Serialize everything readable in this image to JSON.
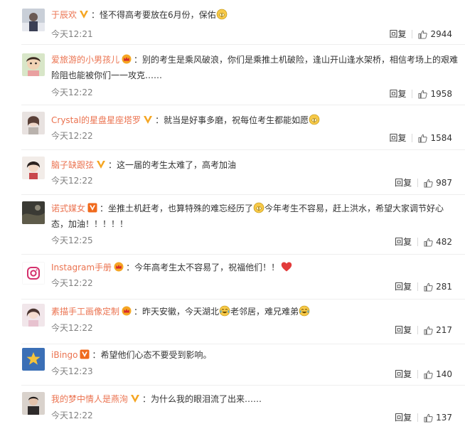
{
  "comments": [
    {
      "user": "于辰欢",
      "badge": "vip-yellow",
      "text": "：怪不得高考要放在6月份，保佑",
      "emoji": "praying-emoji",
      "text_after": "",
      "time": "今天12:21",
      "reply": "回复",
      "likes": "2944"
    },
    {
      "user": "爱旅游的小男孩儿",
      "badge": "crown-member",
      "text": "：别的考生是乘风破浪，你们是乘推土机破险，逢山开山逢水架桥，相信考场上的艰难险阻也能被你们一一攻克……",
      "emoji": "",
      "text_after": "",
      "time": "今天12:22",
      "reply": "回复",
      "likes": "1958"
    },
    {
      "user": "Crystal的星盘星座塔罗",
      "badge": "vip-yellow",
      "text": "：就当是好事多磨，祝每位考生都能如愿",
      "emoji": "praying-emoji",
      "text_after": "",
      "time": "今天12:22",
      "reply": "回复",
      "likes": "1584"
    },
    {
      "user": "脑子缺跟弦",
      "badge": "vip-yellow",
      "text": "：这一届的考生太难了，高考加油",
      "emoji": "",
      "text_after": "",
      "time": "今天12:22",
      "reply": "回复",
      "likes": "987"
    },
    {
      "user": "诺式媒女",
      "badge": "vip-orange",
      "text": "：坐推土机赶考，也算特殊的难忘经历了",
      "emoji": "praying-emoji",
      "text_after": "今年考生不容易，赶上洪水，希望大家调节好心态，加油！！！！！",
      "time": "今天12:25",
      "reply": "回复",
      "likes": "482"
    },
    {
      "user": "Instagram手册",
      "badge": "crown-member",
      "text": "：今年高考生太不容易了，祝福他们！！",
      "emoji": "heart-emoji",
      "text_after": "",
      "time": "今天12:22",
      "reply": "回复",
      "likes": "281"
    },
    {
      "user": "素描手工画像定制",
      "badge": "crown-member",
      "text": "：昨天安徽，今天湖北",
      "emoji": "laugh-cry-emoji",
      "text_after": "老邻居，难兄难弟",
      "emoji2": "laugh-cry-emoji",
      "time": "今天12:22",
      "reply": "回复",
      "likes": "217"
    },
    {
      "user": "iBingo",
      "badge": "vip-orange",
      "text": "：希望他们心态不要受到影响。",
      "emoji": "",
      "text_after": "",
      "time": "今天12:23",
      "reply": "回复",
      "likes": "140"
    },
    {
      "user": "我的梦中情人是燕洵",
      "badge": "vip-yellow",
      "text": "：为什么我的眼泪流了出来……",
      "emoji": "",
      "text_after": "",
      "time": "今天12:22",
      "reply": "回复",
      "likes": "137"
    }
  ],
  "colors": {
    "username": "#eb7350",
    "time": "#808080",
    "text": "#333333",
    "divider": "#eeeeee"
  }
}
